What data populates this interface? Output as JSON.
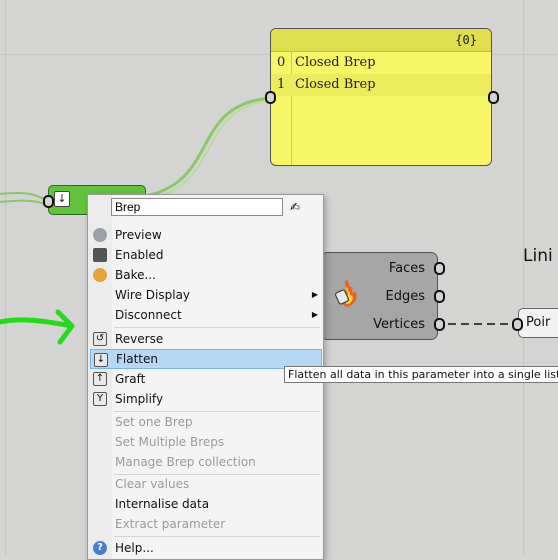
{
  "panel": {
    "path": "{0}",
    "rows": [
      {
        "index": "0",
        "value": "Closed Brep"
      },
      {
        "index": "1",
        "value": "Closed Brep"
      }
    ]
  },
  "component": {
    "outputs": [
      "Faces",
      "Edges",
      "Vertices"
    ],
    "icon": "deconstruct-brep-icon"
  },
  "param": {
    "icon": "flatten-icon"
  },
  "side": {
    "label_fragment": "Lini",
    "point_fragment": "Poir"
  },
  "menu": {
    "name_value": "Brep",
    "items": [
      {
        "label": "Preview",
        "icon": "preview-icon",
        "enabled": true
      },
      {
        "label": "Enabled",
        "icon": "enabled-icon",
        "enabled": true
      },
      {
        "label": "Bake...",
        "icon": "bake-icon",
        "enabled": true
      },
      {
        "label": "Wire Display",
        "icon": "",
        "enabled": true,
        "submenu": true
      },
      {
        "label": "Disconnect",
        "icon": "",
        "enabled": true,
        "submenu": true
      },
      {
        "label": "Reverse",
        "icon": "reverse-icon",
        "enabled": true
      },
      {
        "label": "Flatten",
        "icon": "flatten-icon",
        "enabled": true,
        "highlighted": true
      },
      {
        "label": "Graft",
        "icon": "graft-icon",
        "enabled": true
      },
      {
        "label": "Simplify",
        "icon": "simplify-icon",
        "enabled": true
      },
      {
        "label": "Set one Brep",
        "icon": "",
        "enabled": false
      },
      {
        "label": "Set Multiple Breps",
        "icon": "",
        "enabled": false
      },
      {
        "label": "Manage Brep collection",
        "icon": "",
        "enabled": false
      },
      {
        "label": "Clear values",
        "icon": "",
        "enabled": false
      },
      {
        "label": "Internalise data",
        "icon": "",
        "enabled": true
      },
      {
        "label": "Extract parameter",
        "icon": "",
        "enabled": false
      },
      {
        "label": "Help...",
        "icon": "help-icon",
        "enabled": true
      }
    ]
  },
  "tooltip": "Flatten all data in this parameter into a single list",
  "colors": {
    "canvas": "#d4d4d2",
    "panel": "#f6f668",
    "param": "#62c23e",
    "highlight": "#b6d8f2",
    "annotation_arrow": "#27d81c"
  }
}
